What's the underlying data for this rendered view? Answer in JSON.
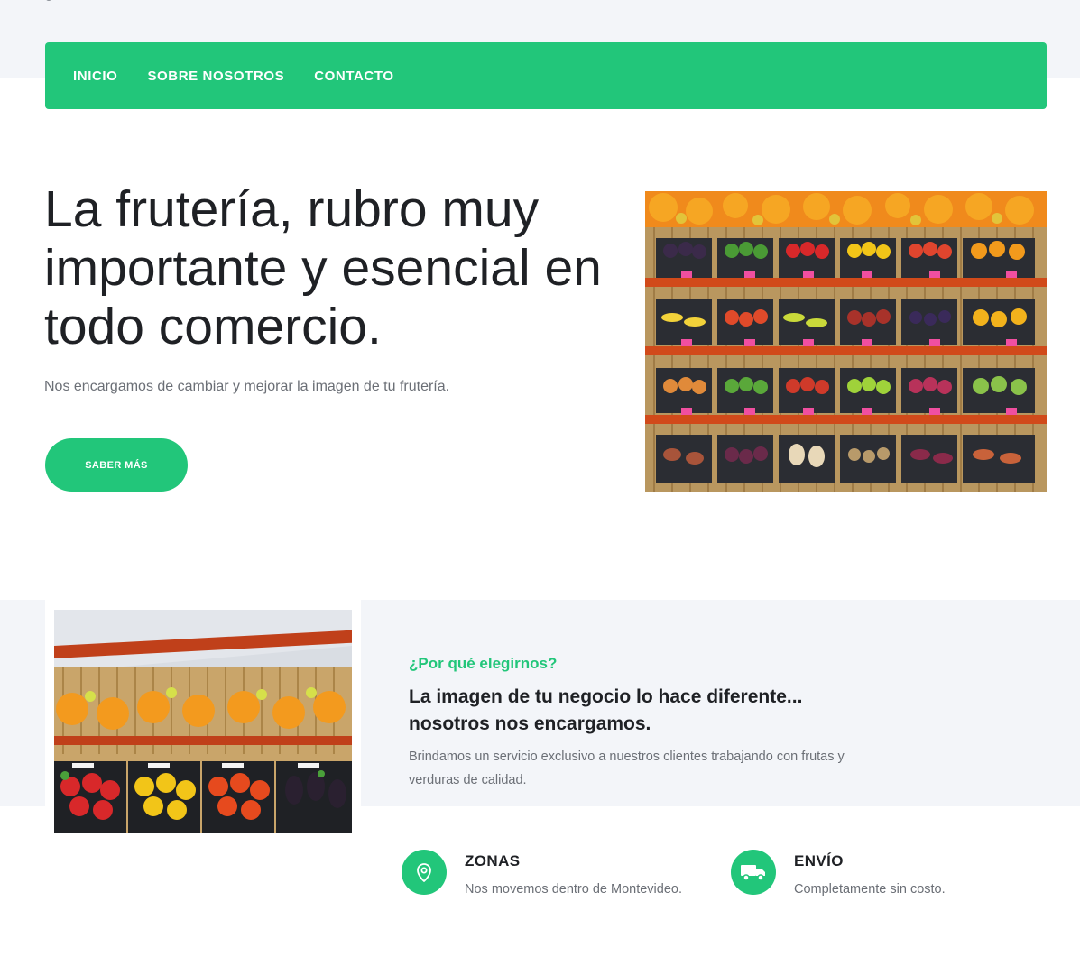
{
  "nav": {
    "items": [
      "INICIO",
      "SOBRE NOSOTROS",
      "CONTACTO"
    ]
  },
  "hero": {
    "title": "La frutería, rubro muy importante y esencial en todo comercio.",
    "subtitle": "Nos encargamos de cambiar y mejorar la imagen de tu frutería.",
    "button_label": "SABER MÁS"
  },
  "why": {
    "kicker": "¿Por qué elegirnos?",
    "title": "La imagen de tu negocio lo hace diferente... nosotros nos encargamos.",
    "text": "Brindamos un servicio exclusivo a nuestros clientes trabajando con frutas y verduras de calidad."
  },
  "features": [
    {
      "icon": "map-pin-icon",
      "title": "ZONAS",
      "text": "Nos movemos dentro de Montevideo."
    },
    {
      "icon": "truck-icon",
      "title": "ENVÍO",
      "text": "Completamente sin costo."
    }
  ],
  "colors": {
    "accent": "#22c67a",
    "band": "#f3f5f9",
    "heading": "#1f2125",
    "muted": "#6b6f76"
  }
}
